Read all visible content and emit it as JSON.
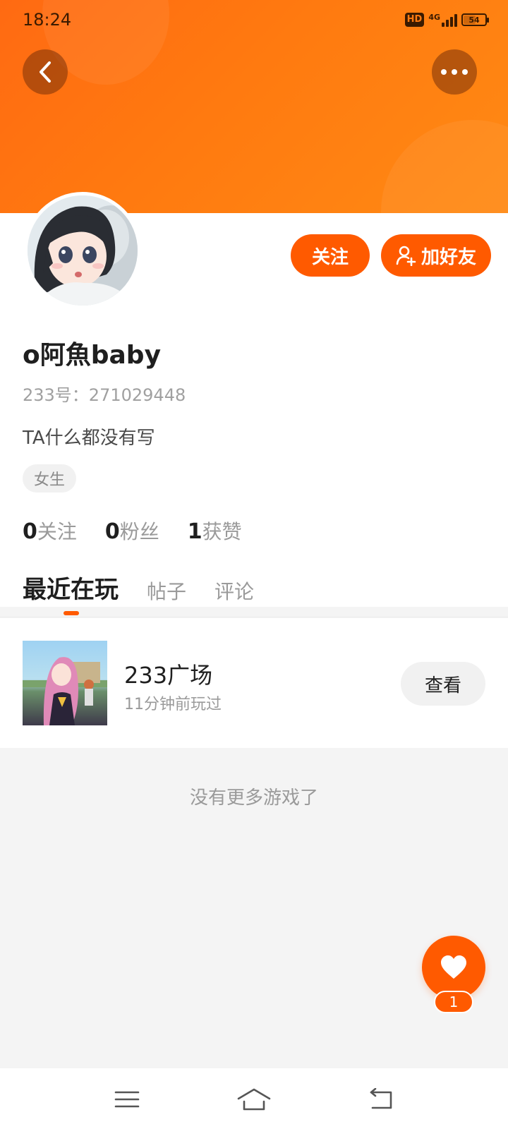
{
  "status_bar": {
    "time": "18:24",
    "hd": "HD",
    "network": "4G",
    "battery": "54"
  },
  "header": {
    "back_icon": "chevron-left-icon",
    "more_icon": "more-dots-icon"
  },
  "profile": {
    "follow_label": "关注",
    "add_friend_label": "加好友",
    "username": "o阿魚baby",
    "uid": "233号：271029448",
    "bio": "TA什么都没有写",
    "gender_tag": "女生",
    "stats": [
      {
        "count": "0",
        "label": "关注"
      },
      {
        "count": "0",
        "label": "粉丝"
      },
      {
        "count": "1",
        "label": "获赞"
      }
    ]
  },
  "tabs": [
    {
      "label": "最近在玩",
      "active": true
    },
    {
      "label": "帖子",
      "active": false
    },
    {
      "label": "评论",
      "active": false
    }
  ],
  "recent_games": [
    {
      "name": "233广场",
      "played": "11分钟前玩过",
      "action": "查看"
    }
  ],
  "empty_text": "没有更多游戏了",
  "like": {
    "count": "1"
  },
  "colors": {
    "brand": "#ff5a00",
    "banner": "#ff7a10",
    "background": "#f4f4f4"
  }
}
